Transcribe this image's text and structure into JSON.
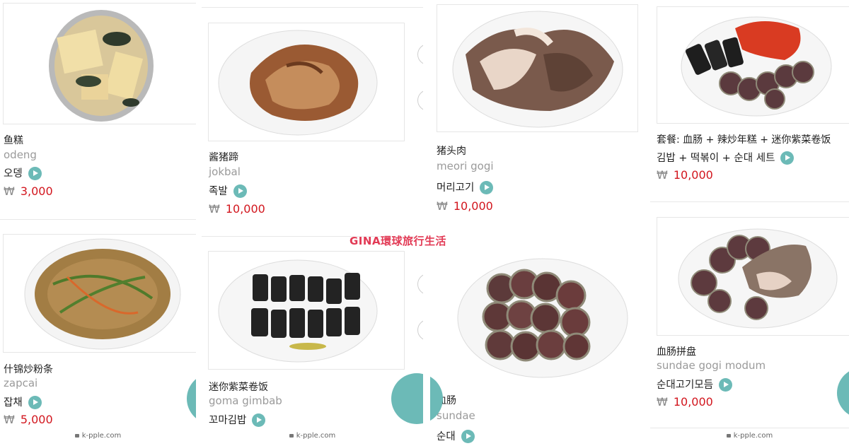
{
  "currency": "₩",
  "site": "k-pple.com",
  "watermark": "GINA環球旅行生活",
  "colors": {
    "accent": "#6cbab7",
    "price": "#d2161e"
  },
  "icons": {
    "fab": "fork-plate-icon",
    "play": "play-icon",
    "lock": "lock-icon"
  },
  "items": [
    {
      "cn": "鱼糕",
      "rom": "odeng",
      "ko": "오뎅",
      "price": "3,000"
    },
    {
      "cn": "什锦炒粉条",
      "rom": "zapcai",
      "ko": "잡채",
      "price": "5,000"
    },
    {
      "cn": "酱猪蹄",
      "rom": "jokbal",
      "ko": "족발",
      "price": "10,000"
    },
    {
      "cn": "迷你紫菜卷饭",
      "rom": "goma gimbab",
      "ko": "꼬마김밥"
    },
    {
      "cn": "猪头肉",
      "rom": "meori gogi",
      "ko": "머리고기",
      "price": "10,000"
    },
    {
      "cn": "血肠",
      "rom": "sundae",
      "ko": "순대"
    },
    {
      "cn": "套餐: 血肠 + 辣炒年糕 + 迷你紫菜卷饭",
      "ko": "김밥 + 떡볶이 + 순대 세트",
      "price": "10,000"
    },
    {
      "cn": "血肠拼盘",
      "rom": "sundae gogi modum",
      "ko": "순대고기모듬",
      "price": "10,000"
    }
  ]
}
